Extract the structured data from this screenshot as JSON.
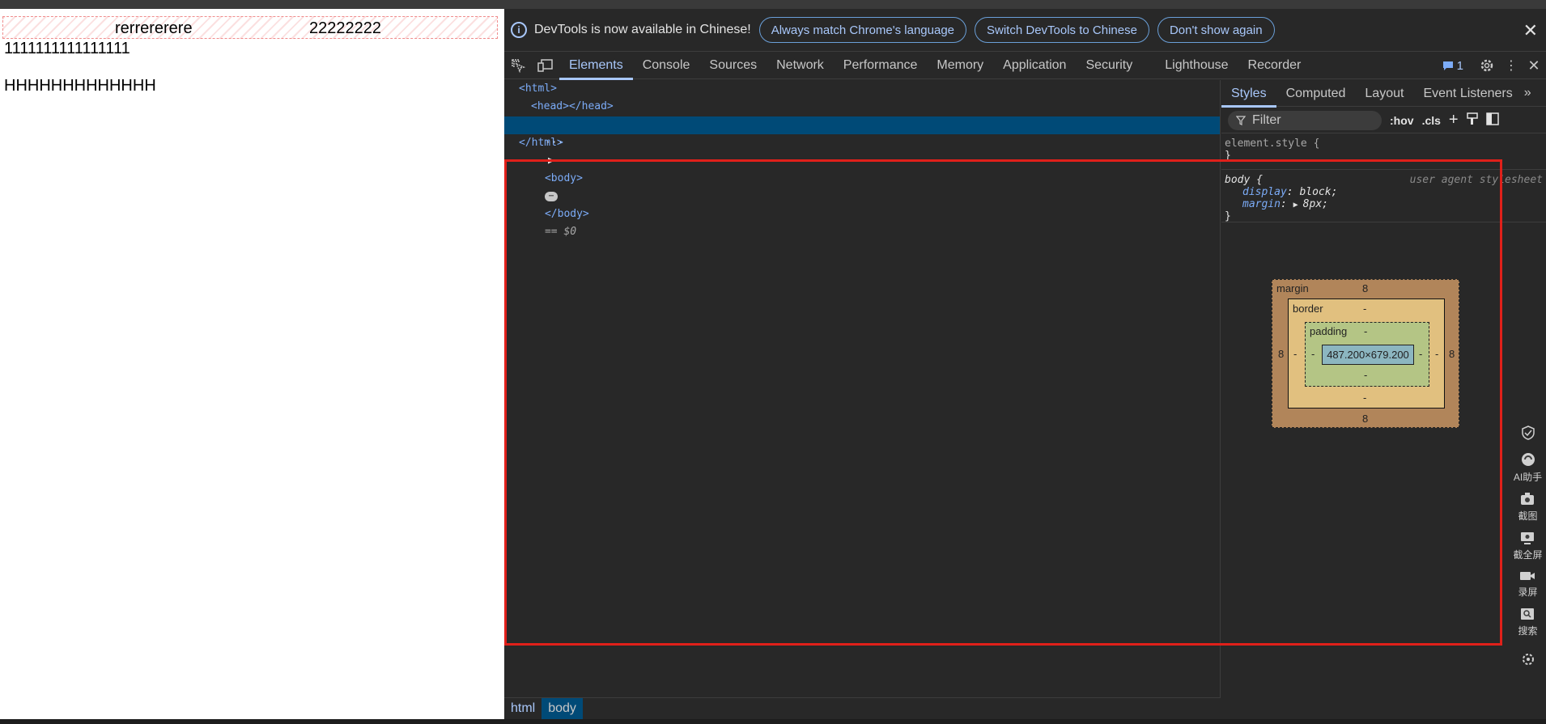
{
  "page": {
    "row_text_left": "rerrererere",
    "row_text_right": "22222222",
    "line1": "1111111111111111",
    "line2": "HHHHHHHHHHHHH"
  },
  "infobar": {
    "message": "DevTools is now available in Chinese!",
    "btn_match": "Always match Chrome's language",
    "btn_switch": "Switch DevTools to Chinese",
    "btn_dismiss": "Don't show again"
  },
  "tabs": [
    "Elements",
    "Console",
    "Sources",
    "Network",
    "Performance",
    "Memory",
    "Application",
    "Security",
    "Lighthouse",
    "Recorder"
  ],
  "issues_count": "1",
  "dom": {
    "html_open": "<html>",
    "head": "<head></head>",
    "body_open": "<body>",
    "body_close": "</body>",
    "selected_marker": "== $0",
    "html_close": "</html>"
  },
  "breadcrumbs": [
    "html",
    "body"
  ],
  "styles_tabs": [
    "Styles",
    "Computed",
    "Layout",
    "Event Listeners"
  ],
  "filter": {
    "placeholder": "Filter",
    "hov": ":hov",
    "cls": ".cls"
  },
  "rules": {
    "element_style": "element.style {",
    "close_brace": "}",
    "body_selector": "body {",
    "source": "user agent stylesheet",
    "prop1": "display",
    "val1": "block;",
    "prop2": "margin",
    "val2": "8px;"
  },
  "boxmodel": {
    "margin_label": "margin",
    "margin_top": "8",
    "margin_bottom": "8",
    "margin_left": "8",
    "margin_right": "8",
    "border_label": "border",
    "border_value": "-",
    "padding_label": "padding",
    "padding_value": "-",
    "content": "487.200×679.200"
  },
  "sidetool": {
    "ai": "AI助手",
    "screenshot": "截图",
    "fullscreen_shot": "截全屏",
    "record": "录屏",
    "search": "搜索"
  }
}
